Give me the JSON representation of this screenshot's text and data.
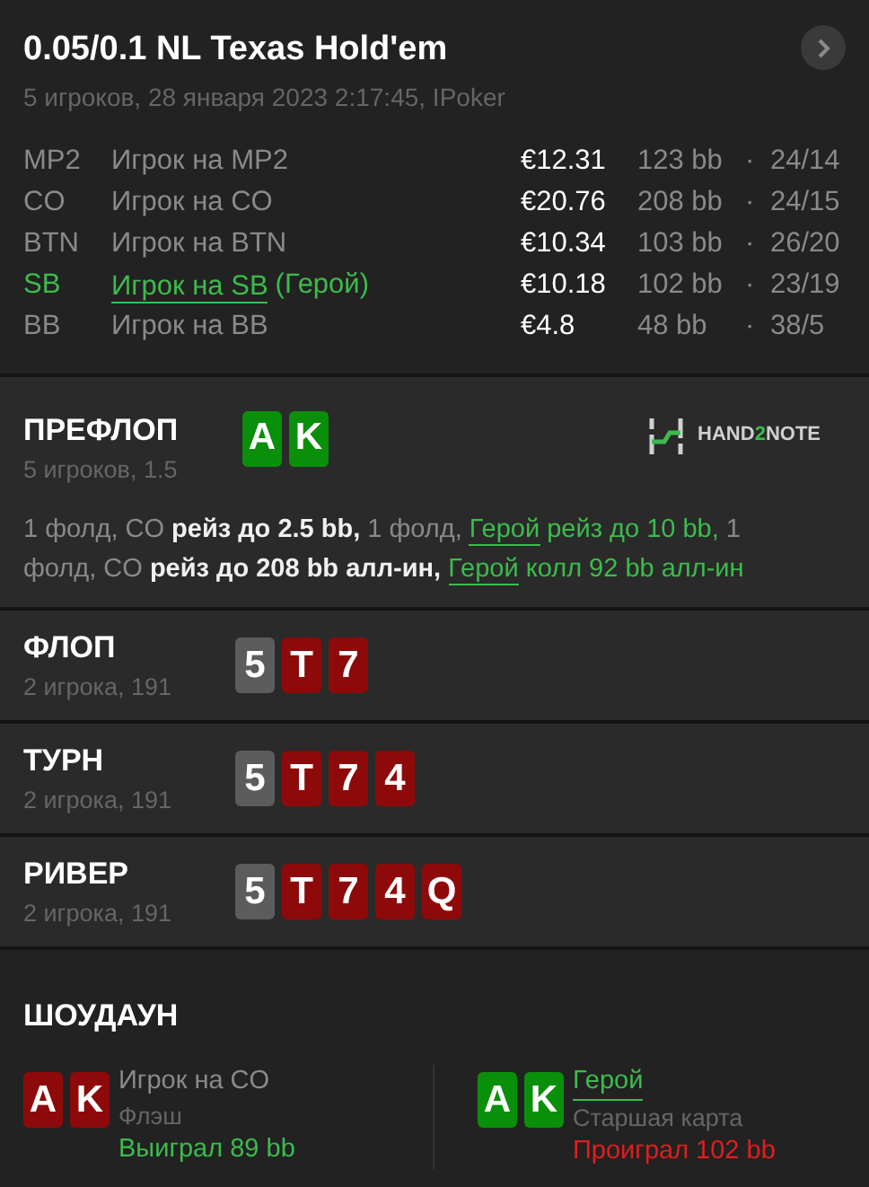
{
  "header": {
    "title": "0.05/0.1 NL Texas Hold'em",
    "subtitle": "5 игроков, 28 января 2023 2:17:45, IPoker"
  },
  "players": [
    {
      "position": "MP2",
      "name": "Игрок на MP2",
      "hero": false,
      "stack": "€12.31",
      "bb": "123 bb",
      "stats": "24/14"
    },
    {
      "position": "CO",
      "name": "Игрок на CO",
      "hero": false,
      "stack": "€20.76",
      "bb": "208 bb",
      "stats": "24/15"
    },
    {
      "position": "BTN",
      "name": "Игрок на BTN",
      "hero": false,
      "stack": "€10.34",
      "bb": "103 bb",
      "stats": "26/20"
    },
    {
      "position": "SB",
      "name": "Игрок на SB",
      "suffix": "(Герой)",
      "hero": true,
      "stack": "€10.18",
      "bb": "102 bb",
      "stats": "23/19"
    },
    {
      "position": "BB",
      "name": "Игрок на BB",
      "hero": false,
      "stack": "€4.8",
      "bb": "48 bb",
      "stats": "38/5"
    }
  ],
  "separator": "·",
  "preflop": {
    "title": "ПРЕФЛОП",
    "info": "5 игроков, 1.5",
    "cards": [
      {
        "rank": "A",
        "color": "#0a8f0a"
      },
      {
        "rank": "K",
        "color": "#0a8f0a"
      }
    ],
    "logo": [
      "HAND",
      "2",
      "NOTE"
    ],
    "actions": [
      {
        "kind": "muted",
        "text": "1 фолд, CO "
      },
      {
        "kind": "bold",
        "text": "рейз до 2.5 bb,"
      },
      {
        "kind": "muted",
        "text": " 1 фолд, "
      },
      {
        "kind": "hero-link",
        "text": "Герой"
      },
      {
        "kind": "hero",
        "text": " рейз до 10 bb,"
      },
      {
        "kind": "muted",
        "text": " 1 фолд, CO "
      },
      {
        "kind": "bold",
        "text": "рейз до 208 bb алл-ин,"
      },
      {
        "kind": "hero-link",
        "text": "Герой"
      },
      {
        "kind": "hero",
        "text": " колл 92 bb алл-ин"
      }
    ]
  },
  "streets": [
    {
      "title": "ФЛОП",
      "info": "2 игрока, 191",
      "cards": [
        {
          "rank": "5",
          "color": "#5c5c5c"
        },
        {
          "rank": "T",
          "color": "#8e0a0a"
        },
        {
          "rank": "7",
          "color": "#8e0a0a"
        }
      ]
    },
    {
      "title": "ТУРН",
      "info": "2 игрока, 191",
      "cards": [
        {
          "rank": "5",
          "color": "#5c5c5c"
        },
        {
          "rank": "T",
          "color": "#8e0a0a"
        },
        {
          "rank": "7",
          "color": "#8e0a0a"
        },
        {
          "rank": "4",
          "color": "#8e0a0a"
        }
      ]
    },
    {
      "title": "РИВЕР",
      "info": "2 игрока, 191",
      "cards": [
        {
          "rank": "5",
          "color": "#5c5c5c"
        },
        {
          "rank": "T",
          "color": "#8e0a0a"
        },
        {
          "rank": "7",
          "color": "#8e0a0a"
        },
        {
          "rank": "4",
          "color": "#8e0a0a"
        },
        {
          "rank": "Q",
          "color": "#8e0a0a"
        }
      ]
    }
  ],
  "showdown": {
    "title": "ШОУДАУН",
    "players": [
      {
        "name": "Игрок на CO",
        "hero": false,
        "hand": "Флэш",
        "result": "Выиграл 89 bb",
        "won": true,
        "cards": [
          {
            "rank": "A",
            "color": "#8e0a0a"
          },
          {
            "rank": "K",
            "color": "#8e0a0a"
          }
        ]
      },
      {
        "name": "Герой",
        "hero": true,
        "hand": "Старшая карта",
        "result": "Проиграл 102 bb",
        "won": false,
        "cards": [
          {
            "rank": "A",
            "color": "#0a8f0a"
          },
          {
            "rank": "K",
            "color": "#0a8f0a"
          }
        ]
      }
    ]
  }
}
